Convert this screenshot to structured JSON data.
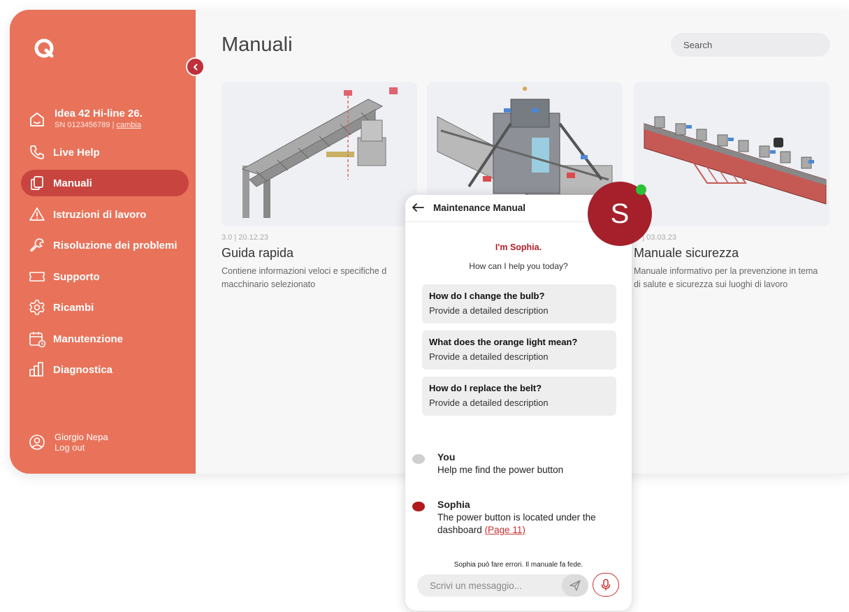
{
  "sidebar": {
    "machine": {
      "name": "Idea 42 Hi-line 26.",
      "sn": "SN 0123456789",
      "sep": " | ",
      "change": "cambia"
    },
    "items": [
      {
        "label": "Live Help",
        "icon": "phone-icon"
      },
      {
        "label": "Manuali",
        "icon": "manual-icon",
        "active": true
      },
      {
        "label": "Istruzioni di lavoro",
        "icon": "warning-icon"
      },
      {
        "label": "Risoluzione dei problemi",
        "icon": "wrench-icon"
      },
      {
        "label": "Supporto",
        "icon": "ticket-icon"
      },
      {
        "label": "Ricambi",
        "icon": "gear-icon"
      },
      {
        "label": "Manutenzione",
        "icon": "calendar-icon"
      },
      {
        "label": "Diagnostica",
        "icon": "chart-icon"
      }
    ],
    "user": {
      "name": "Giorgio Nepa",
      "logout": "Log out"
    }
  },
  "main": {
    "title": "Manuali",
    "search_placeholder": "Search",
    "cards": [
      {
        "meta": "3.0 | 20.12.23",
        "title": "Guida rapida",
        "desc": "Contiene informazioni veloci e specifiche d macchinario selezionato"
      },
      {
        "meta": "",
        "title": "",
        "desc": ""
      },
      {
        "meta": ".0 | 03.03.23",
        "title": "Manuale sicurezza",
        "desc": "Manuale informativo per la prevenzione in tema di salute e sicurezza sui luoghi di lavoro"
      }
    ]
  },
  "chat": {
    "title": "Maintenance Manual",
    "greeting": "I'm Sophia.",
    "subtitle": "How can I help you today?",
    "suggestions": [
      {
        "q": "How do I change the bulb?",
        "d": "Provide a detailed description"
      },
      {
        "q": "What does the orange light mean?",
        "d": "Provide a detailed description"
      },
      {
        "q": "How do I replace the belt?",
        "d": "Provide a detailed description"
      }
    ],
    "messages": [
      {
        "sender": "You",
        "text": "Help me find the power button"
      },
      {
        "sender": "Sophia",
        "text": "The power button is located under the dashboard ",
        "link": "(Page 11)"
      }
    ],
    "disclaimer": "Sophia può fare errori. Il manuale fa fede.",
    "input_placeholder": "Scrivi un messaggio...",
    "avatar_letter": "S"
  },
  "colors": {
    "sidebar": "#e8735a",
    "active": "#c8453f",
    "brand_red": "#a5202b",
    "online": "#2cc138"
  }
}
